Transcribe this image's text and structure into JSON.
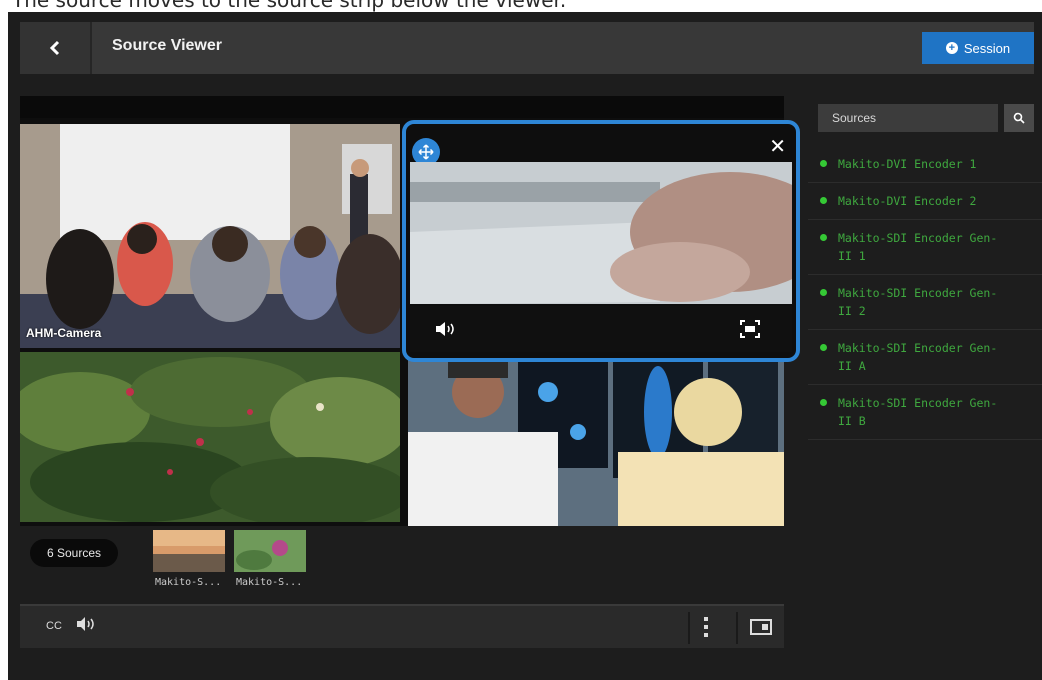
{
  "caption": "The source moves to the source strip below the viewer.",
  "header": {
    "title": "Source Viewer",
    "session_label": "Session"
  },
  "viewer": {
    "tiles": [
      {
        "label": "AHM-Camera"
      }
    ]
  },
  "strip": {
    "count_label": "6 Sources",
    "thumbs": [
      {
        "label": "Makito-S..."
      },
      {
        "label": "Makito-S..."
      }
    ]
  },
  "toolbar": {
    "cc_label": "CC"
  },
  "sidebar": {
    "search_label": "Sources",
    "items": [
      {
        "name_line1": "Makito-DVI Encoder 1",
        "name_line2": ""
      },
      {
        "name_line1": "Makito-DVI Encoder 2",
        "name_line2": ""
      },
      {
        "name_line1": "Makito-SDI Encoder Gen-",
        "name_line2": "II 1"
      },
      {
        "name_line1": "Makito-SDI Encoder Gen-",
        "name_line2": "II 2"
      },
      {
        "name_line1": "Makito-SDI Encoder Gen-",
        "name_line2": "II A"
      },
      {
        "name_line1": "Makito-SDI Encoder Gen-",
        "name_line2": "II B"
      }
    ],
    "status_color": "#35c935",
    "text_color": "#3fa83f"
  },
  "colors": {
    "accent": "#1f74c5",
    "overlay_border": "#2e86d6"
  }
}
